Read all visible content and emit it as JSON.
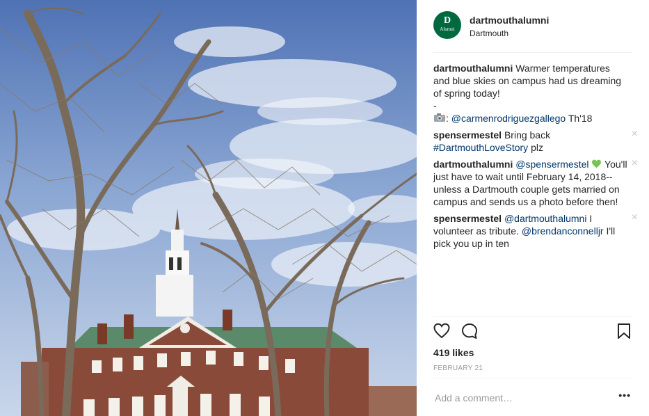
{
  "post": {
    "username": "dartmouthalumni",
    "location": "Dartmouth",
    "avatar_letter": "D",
    "avatar_subtext": "Alumni",
    "avatar_color": "#00693e"
  },
  "caption": {
    "user": "dartmouthalumni",
    "text": "Warmer temperatures and blue skies on campus had us dreaming of spring today!",
    "dash": "-",
    "credit_mention": "@carmenrodriguezgallego",
    "credit_suffix": "Th'18"
  },
  "comments": [
    {
      "user": "spensermestel",
      "text": "Bring back",
      "tag": "#DartmouthLoveStory",
      "after": "plz"
    },
    {
      "user": "dartmouthalumni",
      "mention": "@spensermestel",
      "text": "You'll just have to wait until February 14, 2018--unless a Dartmouth couple gets married on campus and sends us a photo before then!"
    },
    {
      "user": "spensermestel",
      "mention": "@dartmouthalumni",
      "text1": "I volunteer as tribute.",
      "mention2": "@brendanconnelljr",
      "text2": "I'll pick you up in ten"
    }
  ],
  "likes": "419 likes",
  "date": "FEBRUARY 21",
  "add_comment_placeholder": "Add a comment…",
  "more_label": "•••"
}
